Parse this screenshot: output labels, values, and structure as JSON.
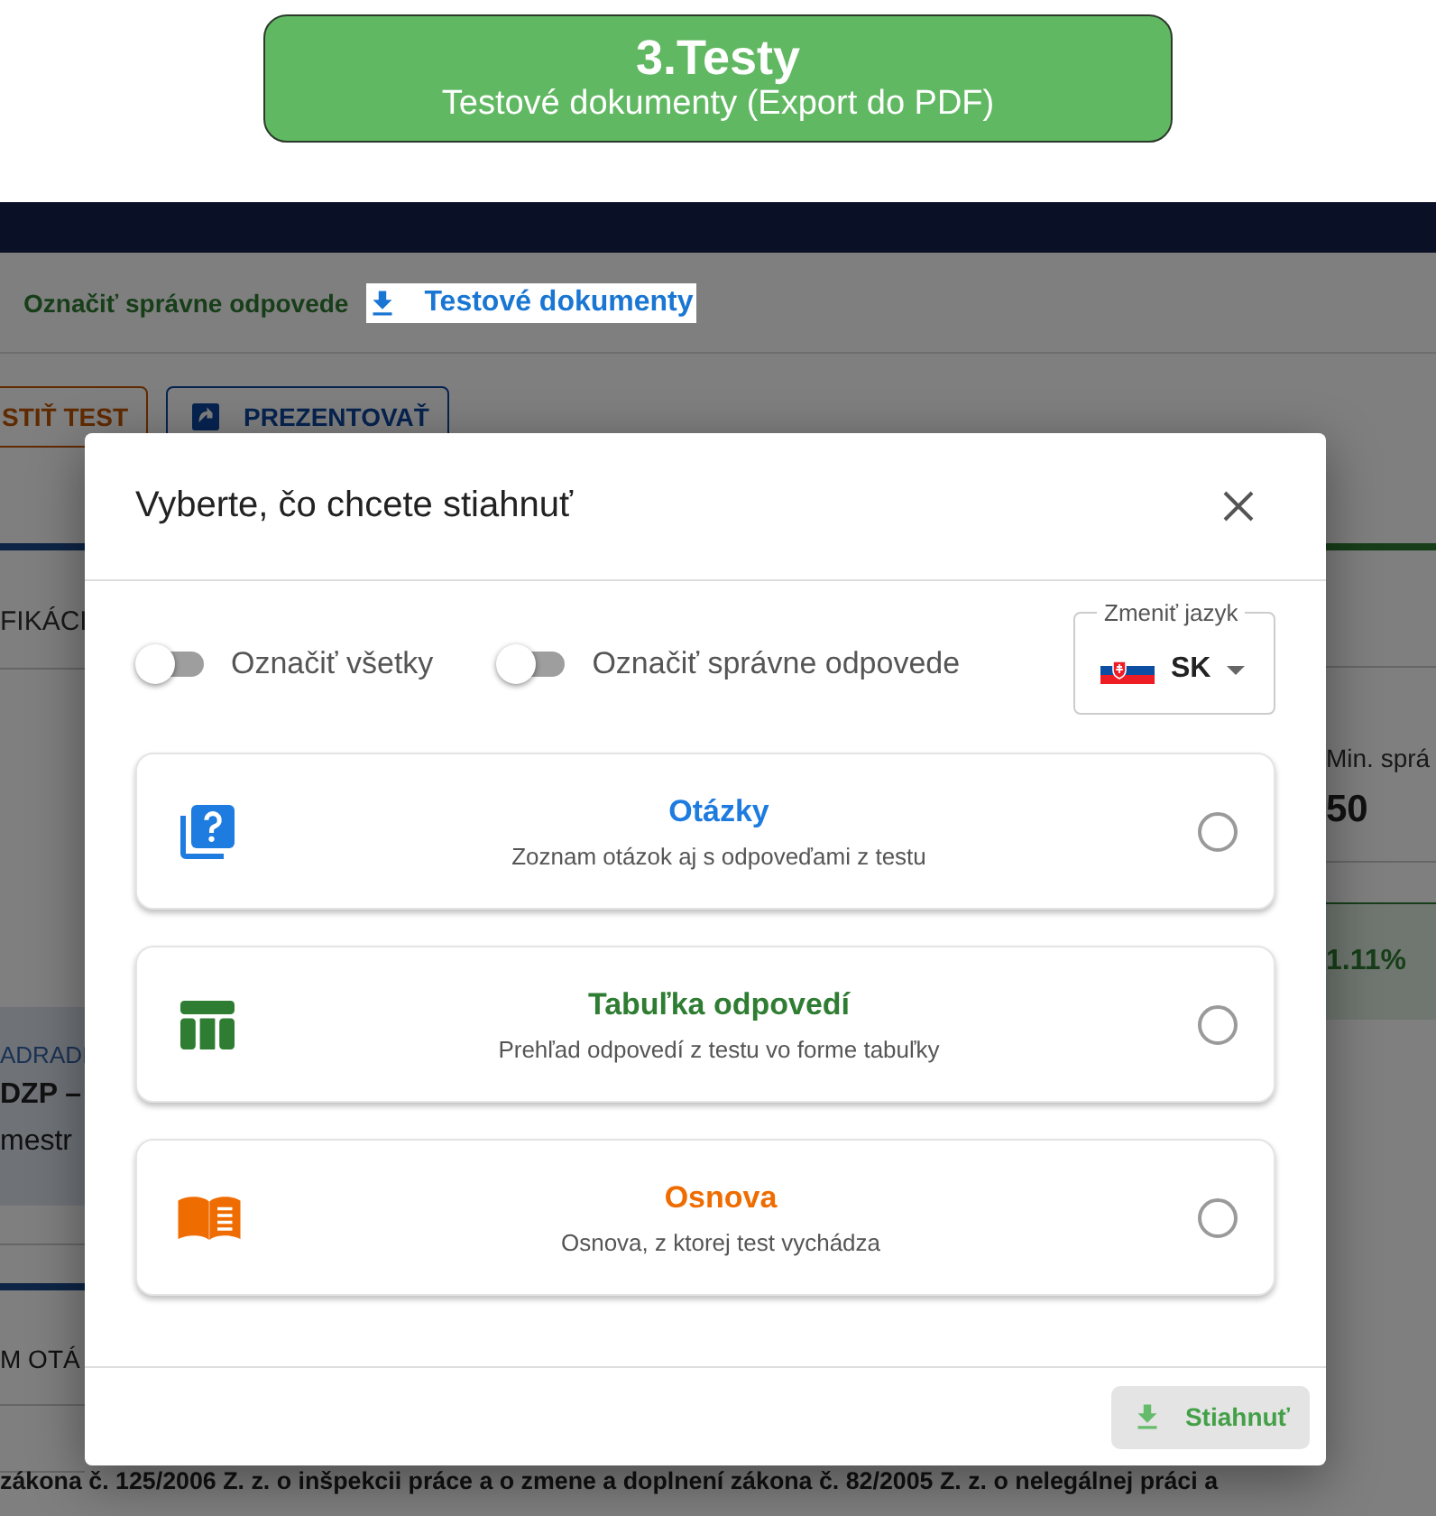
{
  "banner": {
    "title": "3.Testy",
    "subtitle": "Testové dokumenty (Export do PDF)"
  },
  "page": {
    "toolbar": {
      "mark_answers": "Označiť správne odpovede",
      "documents_link": "Testové dokumenty"
    },
    "buttons": [
      {
        "kind": "start",
        "label": "STIŤ TEST"
      },
      {
        "kind": "present",
        "label": "PREZENTOVAŤ"
      }
    ],
    "left_column": {
      "section_heading": "FIKÁCI",
      "panel_label": "ADRADI",
      "panel_title": "DZP –",
      "panel_text": "mestr",
      "list_heading": "M OTÁ"
    },
    "right_column": {
      "label": "Min. sprá",
      "value": "50",
      "percentage": "1.11%"
    },
    "footer_text": "zákona č. 125/2006 Z. z. o inšpekcii práce a o zmene a doplnení zákona č. 82/2005 Z. z. o nelegálnej práci a"
  },
  "dialog": {
    "title": "Vyberte, čo chcete stiahnuť",
    "toggles": [
      {
        "label": "Označiť všetky",
        "on": false
      },
      {
        "label": "Označiť správne odpovede",
        "on": false
      }
    ],
    "language": {
      "label": "Zmeniť jazyk",
      "value": "SK"
    },
    "options": [
      {
        "kind": "questions",
        "title": "Otázky",
        "description": "Zoznam otázok aj s odpoveďami z testu",
        "color": "#1e7be0",
        "selected": false
      },
      {
        "kind": "answers_table",
        "title": "Tabuľka odpovedí",
        "description": "Prehľad odpovedí z testu vo forme tabuľky",
        "color": "#2e7d32",
        "selected": false
      },
      {
        "kind": "syllabus",
        "title": "Osnova",
        "description": "Osnova, z ktorej test vychádza",
        "color": "#ef6c00",
        "selected": false
      }
    ],
    "download_button": {
      "label": "Stiahnuť",
      "disabled": true
    }
  }
}
